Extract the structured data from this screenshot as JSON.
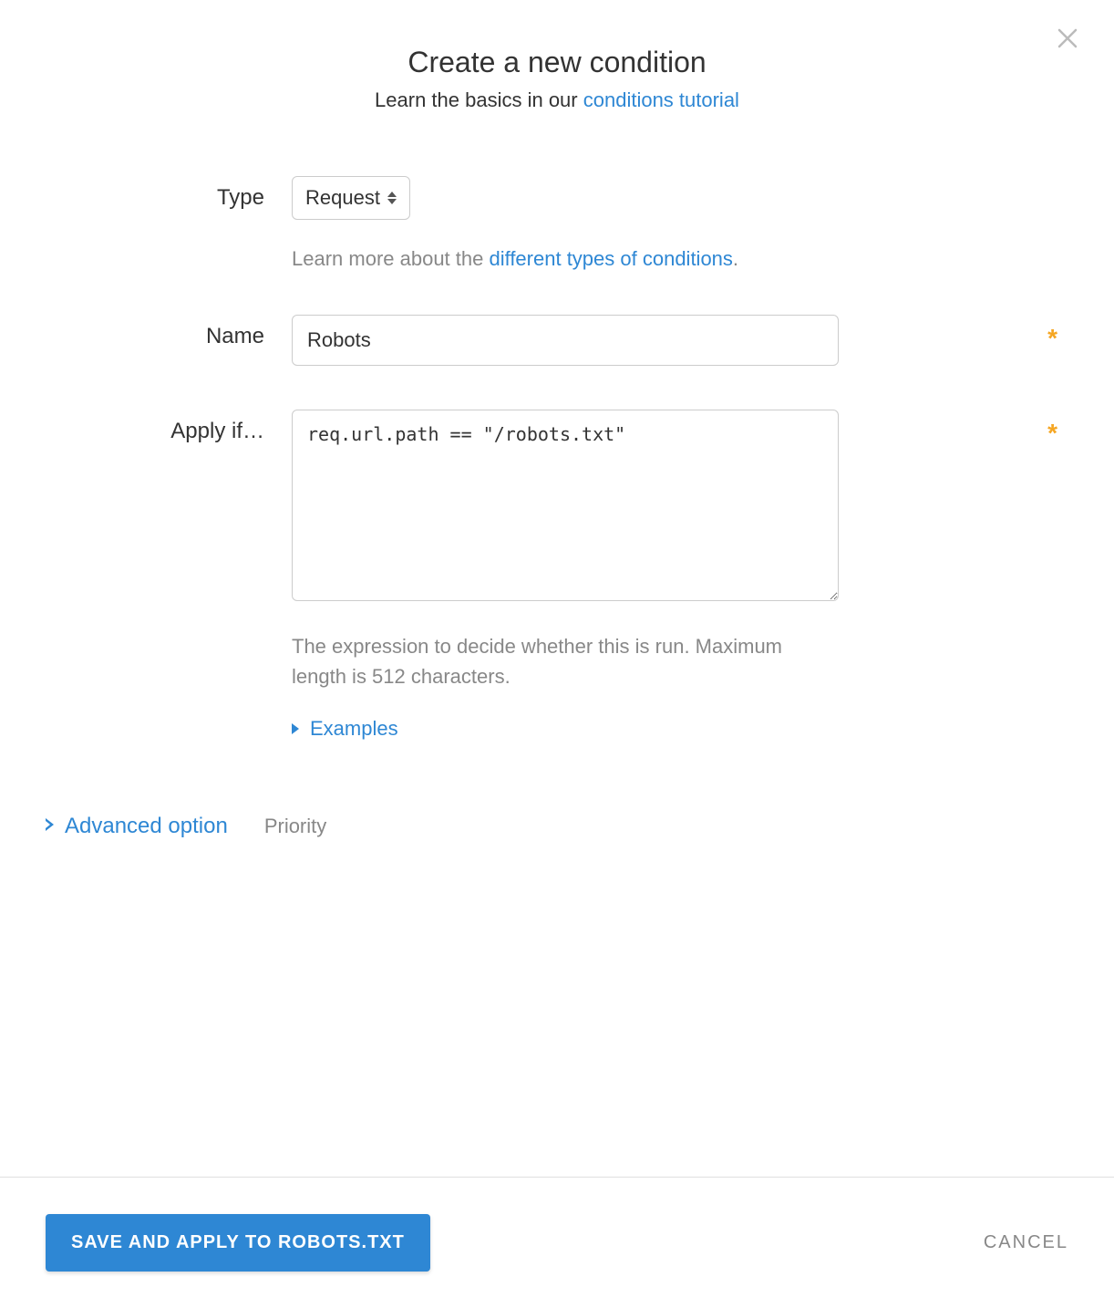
{
  "header": {
    "title": "Create a new condition",
    "subtitle_prefix": "Learn the basics in our ",
    "subtitle_link": "conditions tutorial"
  },
  "form": {
    "type": {
      "label": "Type",
      "value": "Request",
      "help_prefix": "Learn more about the ",
      "help_link": "different types of conditions",
      "help_suffix": "."
    },
    "name": {
      "label": "Name",
      "value": "Robots"
    },
    "apply_if": {
      "label": "Apply if…",
      "value": "req.url.path == \"/robots.txt\"",
      "description": "The expression to decide whether this is run. Maximum length is 512 characters.",
      "examples_label": "Examples"
    }
  },
  "advanced": {
    "toggle_label": "Advanced option",
    "priority_label": "Priority"
  },
  "footer": {
    "save_prefix": "SAVE AND APPLY TO ",
    "save_target": "ROBOTS.TXT",
    "cancel": "CANCEL"
  }
}
